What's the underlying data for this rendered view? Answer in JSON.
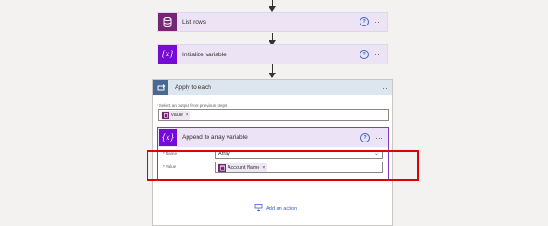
{
  "steps": {
    "list_rows": {
      "title": "List rows",
      "help": "?",
      "more": "···"
    },
    "initialize_variable": {
      "title": "Initialize variable",
      "help": "?",
      "more": "···",
      "icon": "{x}"
    }
  },
  "apply_to_each": {
    "title": "Apply to each",
    "more": "···",
    "select_label": "Select an output from previous steps",
    "select_token": "value",
    "token_remove": "×",
    "append_action": {
      "title": "Append to array variable",
      "help": "?",
      "more": "···",
      "icon": "{x}",
      "name_label": "Name",
      "name_value": "Array",
      "value_label": "Value",
      "value_token": "Account Name",
      "token_remove": "×",
      "required_mark": "*"
    },
    "add_action_label": "Add an action"
  },
  "colors": {
    "dataverse": "#742774",
    "variable": "#770bd6",
    "control": "#486991",
    "highlight": "#e00000",
    "link": "#3b62c9"
  }
}
